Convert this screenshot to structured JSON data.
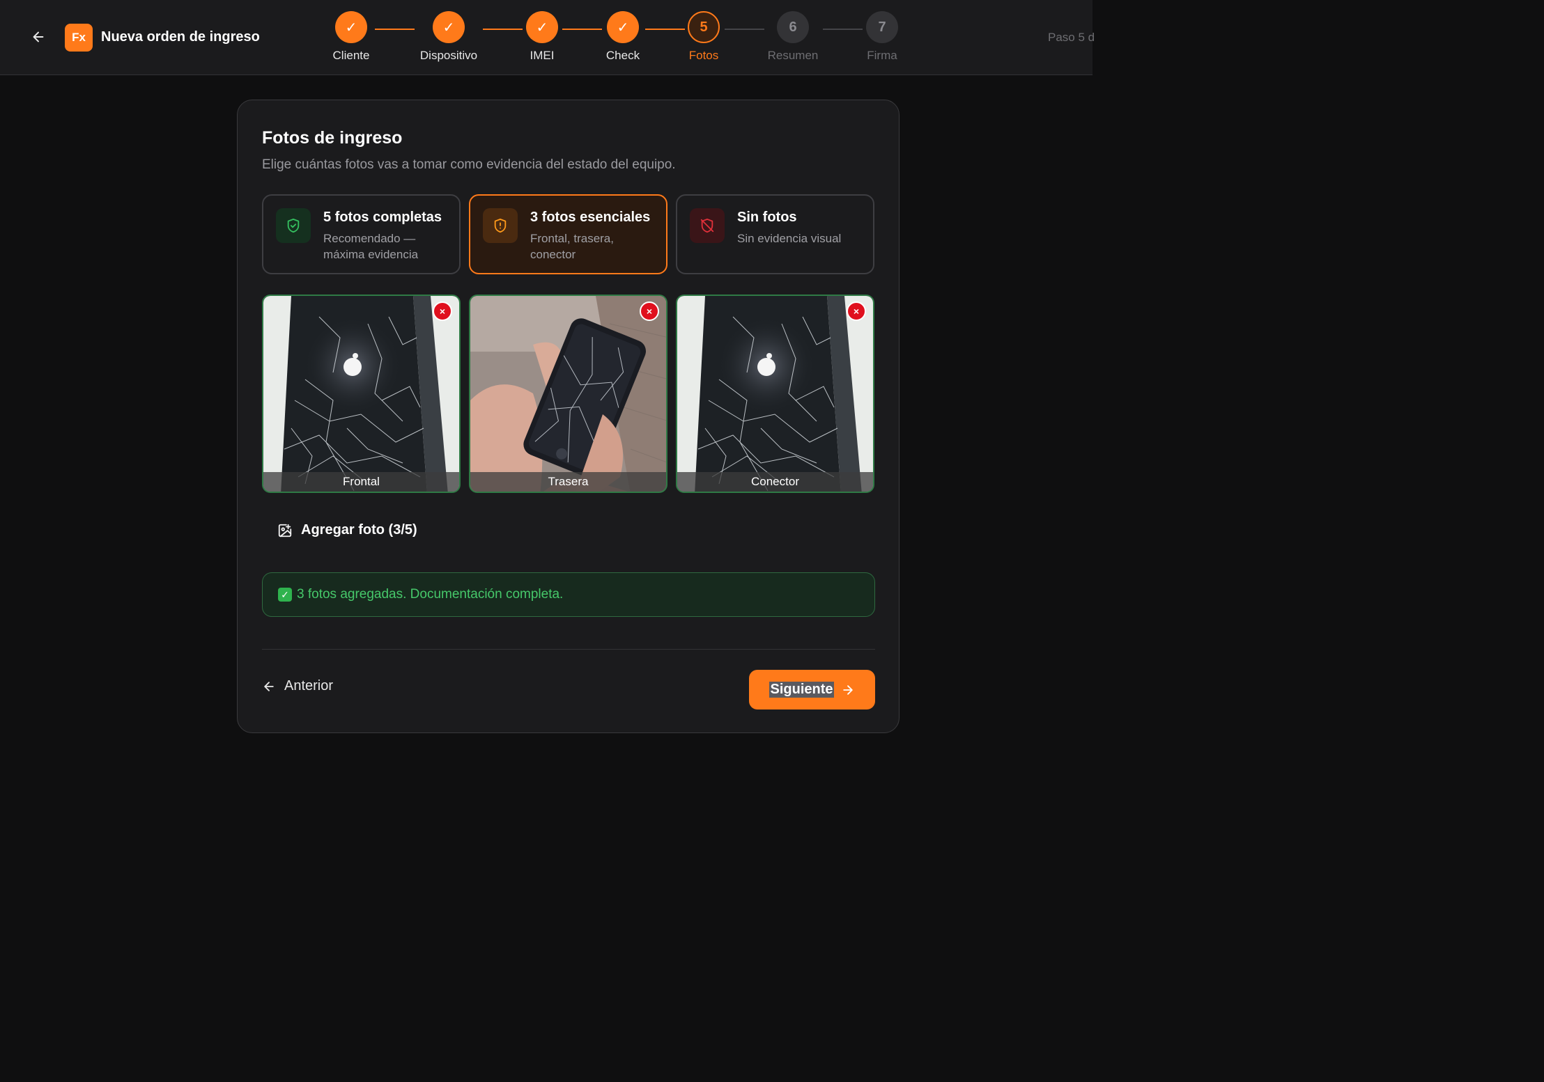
{
  "header": {
    "title": "Nueva orden de ingreso",
    "logo_text": "Fx",
    "step_info": "Paso 5 d",
    "steps": [
      {
        "label": "Cliente",
        "state": "done",
        "symbol": "✓"
      },
      {
        "label": "Dispositivo",
        "state": "done",
        "symbol": "✓"
      },
      {
        "label": "IMEI",
        "state": "done",
        "symbol": "✓"
      },
      {
        "label": "Check",
        "state": "done",
        "symbol": "✓"
      },
      {
        "label": "Fotos",
        "state": "active",
        "symbol": "5"
      },
      {
        "label": "Resumen",
        "state": "pending",
        "symbol": "6"
      },
      {
        "label": "Firma",
        "state": "pending",
        "symbol": "7"
      }
    ]
  },
  "card": {
    "title": "Fotos de ingreso",
    "subtitle": "Elige cuántas fotos vas a tomar como evidencia del estado del equipo.",
    "options": [
      {
        "title": "5 fotos completas",
        "desc": "Recomendado — máxima evidencia",
        "icon": "shield-check-icon",
        "selected": false
      },
      {
        "title": "3 fotos esenciales",
        "desc": "Frontal, trasera, conector",
        "icon": "shield-alert-icon",
        "selected": true
      },
      {
        "title": "Sin fotos",
        "desc": "Sin evidencia visual",
        "icon": "shield-off-icon",
        "selected": false
      }
    ],
    "photos": [
      {
        "caption": "Frontal",
        "remove": "×"
      },
      {
        "caption": "Trasera",
        "remove": "×"
      },
      {
        "caption": "Conector",
        "remove": "×"
      }
    ],
    "add_photo_label": "Agregar foto (3/5)",
    "status_message": "3 fotos agregadas. Documentación completa.",
    "status_check": "✓",
    "prev_label": "Anterior",
    "next_label": "Siguiente"
  },
  "colors": {
    "accent": "#ff7a1a",
    "success": "#46c86a",
    "danger": "#e0101e",
    "background": "#0f0f10",
    "surface": "#1b1b1d"
  }
}
